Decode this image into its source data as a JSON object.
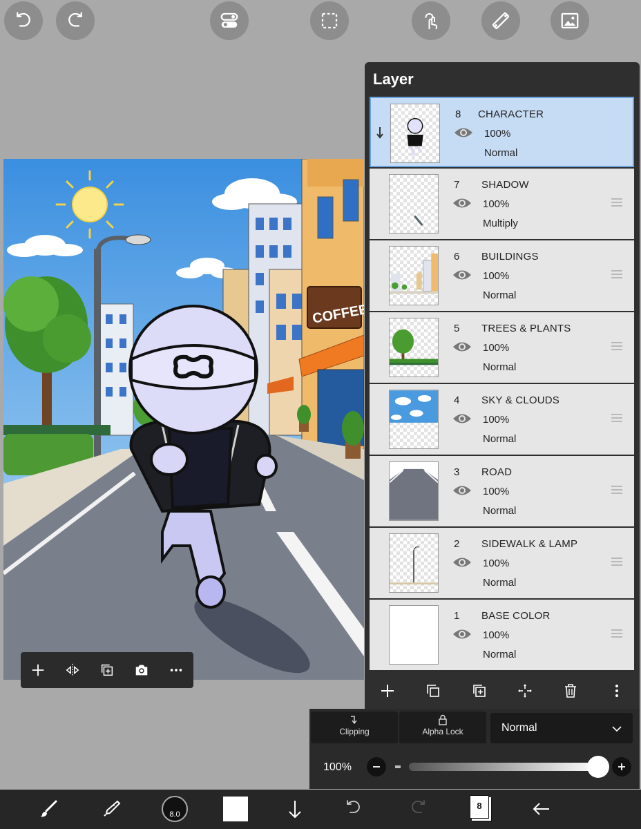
{
  "top_toolbar": {
    "buttons": [
      {
        "icon": "undo-icon"
      },
      {
        "icon": "redo-icon"
      },
      {
        "icon": "toggle-settings-icon"
      },
      {
        "icon": "selection-icon"
      },
      {
        "icon": "touch-icon"
      },
      {
        "icon": "ruler-icon"
      },
      {
        "icon": "image-icon"
      }
    ]
  },
  "canvas": {
    "sign_text": "COFFEE"
  },
  "canvas_toolbar": {
    "buttons": [
      "add-icon",
      "flip-icon",
      "duplicate-icon",
      "camera-icon",
      "more-icon"
    ]
  },
  "layer_panel": {
    "title": "Layer",
    "layers": [
      {
        "number": "8",
        "name": "CHARACTER",
        "opacity": "100%",
        "blend": "Normal",
        "selected": true
      },
      {
        "number": "7",
        "name": "SHADOW",
        "opacity": "100%",
        "blend": "Multiply"
      },
      {
        "number": "6",
        "name": "BUILDINGS",
        "opacity": "100%",
        "blend": "Normal"
      },
      {
        "number": "5",
        "name": "TREES & PLANTS",
        "opacity": "100%",
        "blend": "Normal"
      },
      {
        "number": "4",
        "name": "SKY & CLOUDS",
        "opacity": "100%",
        "blend": "Normal"
      },
      {
        "number": "3",
        "name": "ROAD",
        "opacity": "100%",
        "blend": "Normal"
      },
      {
        "number": "2",
        "name": "SIDEWALK & LAMP",
        "opacity": "100%",
        "blend": "Normal"
      },
      {
        "number": "1",
        "name": "BASE COLOR",
        "opacity": "100%",
        "blend": "Normal"
      }
    ],
    "actions": [
      "add-layer-icon",
      "duplicate-layer-icon",
      "merge-layer-icon",
      "transform-icon",
      "delete-icon",
      "more-vert-icon"
    ]
  },
  "blend_controls": {
    "clipping_label": "Clipping",
    "alpha_lock_label": "Alpha Lock",
    "blend_mode": "Normal",
    "opacity_label": "100%",
    "opacity_value": 1.0
  },
  "bottom_toolbar": {
    "brush_size": "8.0",
    "layer_count": "8",
    "primary_color": "#ffffff"
  },
  "colors": {
    "background": "#a9a9a9",
    "panel": "#2f2f2f",
    "selected_row": "#c6dbf4"
  }
}
